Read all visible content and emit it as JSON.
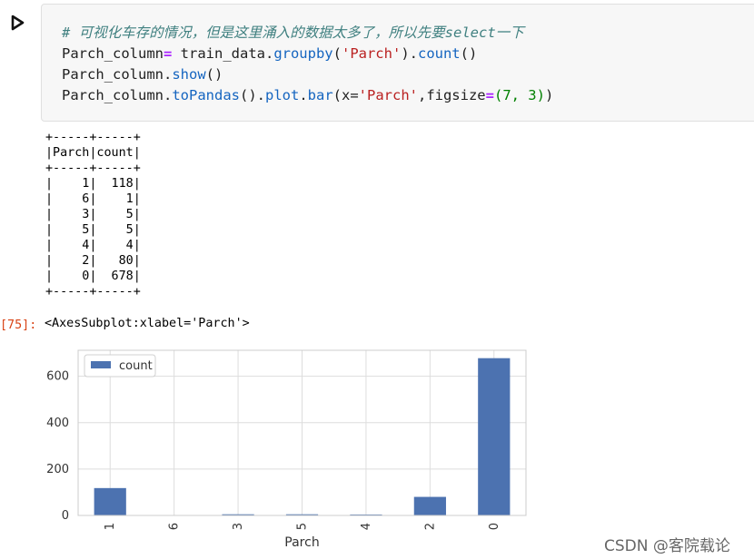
{
  "cell": {
    "comment": "# 可视化车存的情况，但是这里涌入的数据太多了，所以先要select一下",
    "code_line_1": {
      "var": "Parch_column",
      "op": "=",
      "obj": " train_data.",
      "method": "groupby",
      "open": "(",
      "arg": "'Parch'",
      "close": ").",
      "method2": "count",
      "end": "()"
    },
    "code_line_2": {
      "prefix": "Parch_column.",
      "method": "show",
      "end": "()"
    },
    "code_line_3": {
      "prefix": "Parch_column.",
      "m1": "toPandas",
      "m1_end": "().",
      "m2": "plot",
      "sep": ".",
      "m3": "bar",
      "args_open": "(x=",
      "arg_str": "'Parch'",
      "args_mid": ",figsize",
      "eq": "=",
      "tuple": "(7, 3)",
      "args_close": ")"
    }
  },
  "output_table": {
    "border": "+-----+-----+",
    "headers": [
      "Parch",
      "count"
    ],
    "rows": [
      {
        "parch": "1",
        "count": "118"
      },
      {
        "parch": "6",
        "count": "1"
      },
      {
        "parch": "3",
        "count": "5"
      },
      {
        "parch": "5",
        "count": "5"
      },
      {
        "parch": "4",
        "count": "4"
      },
      {
        "parch": "2",
        "count": "80"
      },
      {
        "parch": "0",
        "count": "678"
      }
    ]
  },
  "execution": {
    "prompt": "[75]:",
    "result_text": "<AxesSubplot:xlabel='Parch'>"
  },
  "chart_data": {
    "type": "bar",
    "categories": [
      "1",
      "6",
      "3",
      "5",
      "4",
      "2",
      "0"
    ],
    "series": [
      {
        "name": "count",
        "values": [
          118,
          1,
          5,
          5,
          4,
          80,
          678
        ]
      }
    ],
    "xlabel": "Parch",
    "ylabel": "",
    "yticks": [
      0,
      200,
      400,
      600
    ],
    "ylim": [
      0,
      712
    ],
    "grid": true,
    "legend": "top-left",
    "bar_color": "#4c72b0",
    "grid_color": "#dddddd"
  },
  "watermark": "CSDN @客院载论",
  "colors": {
    "prompt": "#d84315",
    "comment": "#408080",
    "string": "#ba2121",
    "method": "#1565c0",
    "operator": "#aa22ff",
    "number": "#008000"
  }
}
